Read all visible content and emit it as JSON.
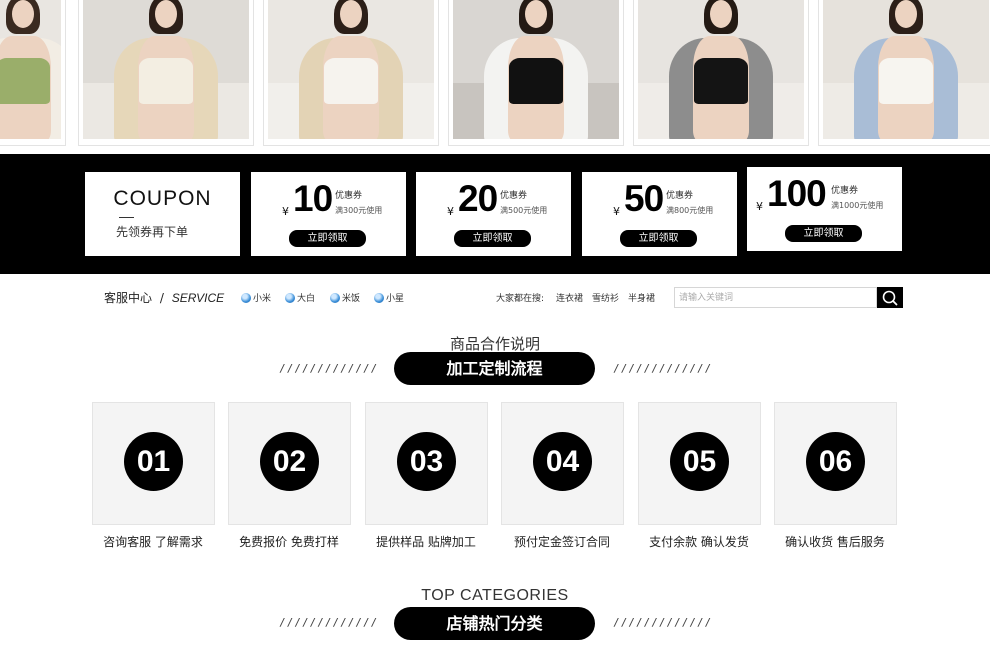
{
  "photos": [
    {
      "name": "green-top",
      "bg": "#e9e6e1",
      "wall": "#f4f2ee",
      "skin": "#ecd3c1",
      "hair": "#3a2a20",
      "top": "#9aae6a",
      "shirt": "#f2ede4"
    },
    {
      "name": "cream-cardigan",
      "bg": "#dedbd6",
      "wall": "#ebe8e3",
      "skin": "#ecd3c1",
      "hair": "#2c1f18",
      "top": "#f3eee2",
      "shirt": "#e6d7b9"
    },
    {
      "name": "beige-shirt",
      "bg": "#eae7e2",
      "wall": "#f1efeb",
      "skin": "#ecd3c1",
      "hair": "#2c1f18",
      "top": "#f6f3ee",
      "shirt": "#e3d3b5"
    },
    {
      "name": "black-camisole",
      "bg": "#d9d6d2",
      "wall": "#c8c4bf",
      "skin": "#ecd3c1",
      "hair": "#241a14",
      "top": "#111111",
      "shirt": "#f3f3f1"
    },
    {
      "name": "black-tank",
      "bg": "#e7e4e0",
      "wall": "#efece8",
      "skin": "#ecd3c1",
      "hair": "#241a14",
      "top": "#141414",
      "shirt": "#8d8d8d"
    },
    {
      "name": "white-camisole",
      "bg": "#e6e2dc",
      "wall": "#eeebe6",
      "skin": "#ecd3c1",
      "hair": "#2c1f18",
      "top": "#f7f5f0",
      "shirt": "#a9bdd6"
    }
  ],
  "coupon_intro": {
    "title": "COUPON",
    "subtitle": "先领券再下单"
  },
  "coupons": [
    {
      "currency": "¥",
      "amount": "10",
      "label": "优惠券",
      "condition": "满300元使用",
      "button": "立即领取"
    },
    {
      "currency": "¥",
      "amount": "20",
      "label": "优惠券",
      "condition": "满500元使用",
      "button": "立即领取"
    },
    {
      "currency": "¥",
      "amount": "50",
      "label": "优惠券",
      "condition": "满800元使用",
      "button": "立即领取"
    },
    {
      "currency": "¥",
      "amount": "100",
      "label": "优惠券",
      "condition": "满1000元使用",
      "button": "立即领取"
    }
  ],
  "service": {
    "label_cn": "客服中心",
    "separator": "/",
    "label_en": "SERVICE",
    "agents": [
      "小米",
      "大白",
      "米饭",
      "小星"
    ]
  },
  "search": {
    "hot_label": "大家都在搜:",
    "keywords": [
      "连衣裙",
      "雪纺衫",
      "半身裙"
    ],
    "placeholder": "请输入关键词"
  },
  "process_section": {
    "title_cn_small": "商品合作说明",
    "title_pill": "加工定制流程",
    "slashes": "/////////////"
  },
  "steps": [
    {
      "number": "01",
      "caption": "咨询客服 了解需求"
    },
    {
      "number": "02",
      "caption": "免费报价 免费打样"
    },
    {
      "number": "03",
      "caption": "提供样品 贴牌加工"
    },
    {
      "number": "04",
      "caption": "预付定金签订合同"
    },
    {
      "number": "05",
      "caption": "支付余款 确认发货"
    },
    {
      "number": "06",
      "caption": "确认收货 售后服务"
    }
  ],
  "categories_section": {
    "title_en": "TOP CATEGORIES",
    "title_pill": "店铺热门分类",
    "slashes": "/////////////"
  },
  "colors": {
    "black": "#000000",
    "step_box": "#f4f4f4",
    "search_border": "#d6d6d6"
  },
  "icons": {
    "search": "search-icon",
    "agent": "chat-bubble-icon"
  }
}
